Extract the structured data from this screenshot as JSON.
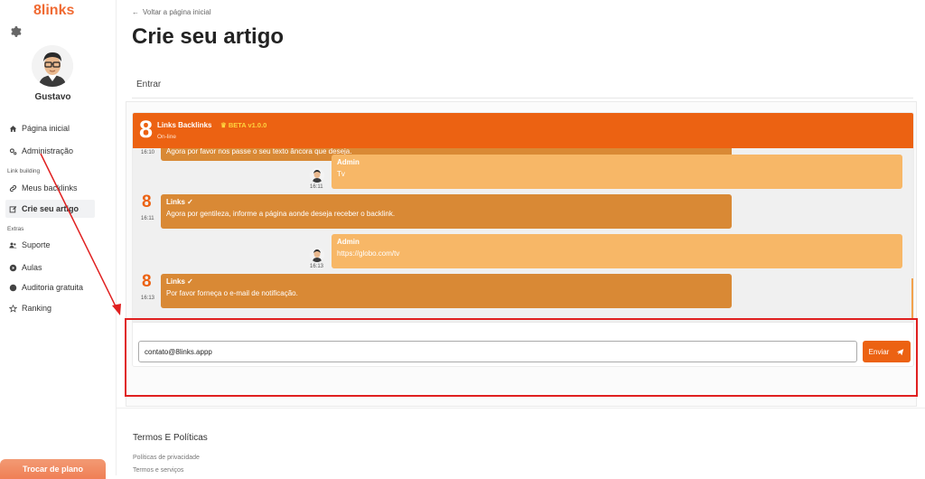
{
  "brand": "8links",
  "user": {
    "name": "Gustavo"
  },
  "nav": {
    "items_top": [
      {
        "label": "Página inicial",
        "icon": "home-icon"
      },
      {
        "label": "Administração",
        "icon": "cogs-icon"
      }
    ],
    "section_link_building": "Link building",
    "items_link": [
      {
        "label": "Meus backlinks",
        "icon": "link-icon"
      },
      {
        "label": "Crie seu artigo",
        "icon": "edit-icon",
        "active": true
      }
    ],
    "section_extras": "Extras",
    "items_extras": [
      {
        "label": "Suporte",
        "icon": "users-icon"
      },
      {
        "label": "Aulas",
        "icon": "play-circle-icon"
      },
      {
        "label": "Auditoria gratuita",
        "icon": "circle-icon"
      },
      {
        "label": "Ranking",
        "icon": "star-icon"
      }
    ],
    "upgrade_button": "Trocar de plano"
  },
  "header": {
    "back_link": "Voltar a página inicial",
    "title": "Crie seu artigo",
    "tab": "Entrar"
  },
  "chat": {
    "logo": "8",
    "name": "Links Backlinks",
    "beta": "BETA v1.0.0",
    "status": "On-line",
    "messages": [
      {
        "from": "bot",
        "time": "16:10",
        "text": "Agora por favor nos passe o seu texto âncora que deseja."
      },
      {
        "from": "admin",
        "author": "Admin",
        "time": "16:11",
        "text": "Tv"
      },
      {
        "from": "bot",
        "author": "Links",
        "time": "16:11",
        "text": "Agora por gentileza, informe a página aonde deseja receber o backlink."
      },
      {
        "from": "admin",
        "author": "Admin",
        "time": "16:13",
        "text": "https://globo.com/tv"
      },
      {
        "from": "bot",
        "author": "Links",
        "time": "16:13",
        "text": "Por favor forneça o e-mail de notificação."
      }
    ],
    "input_value": "contato@8links.appp",
    "send_label": "Enviar"
  },
  "footer": {
    "title": "Termos E Políticas",
    "links": [
      "Políticas de privacidade",
      "Termos e serviços"
    ]
  },
  "colors": {
    "accent": "#ec6212",
    "bot_bubble": "#d98935",
    "admin_bubble": "#f7b767",
    "annotation_red": "#e02020"
  }
}
